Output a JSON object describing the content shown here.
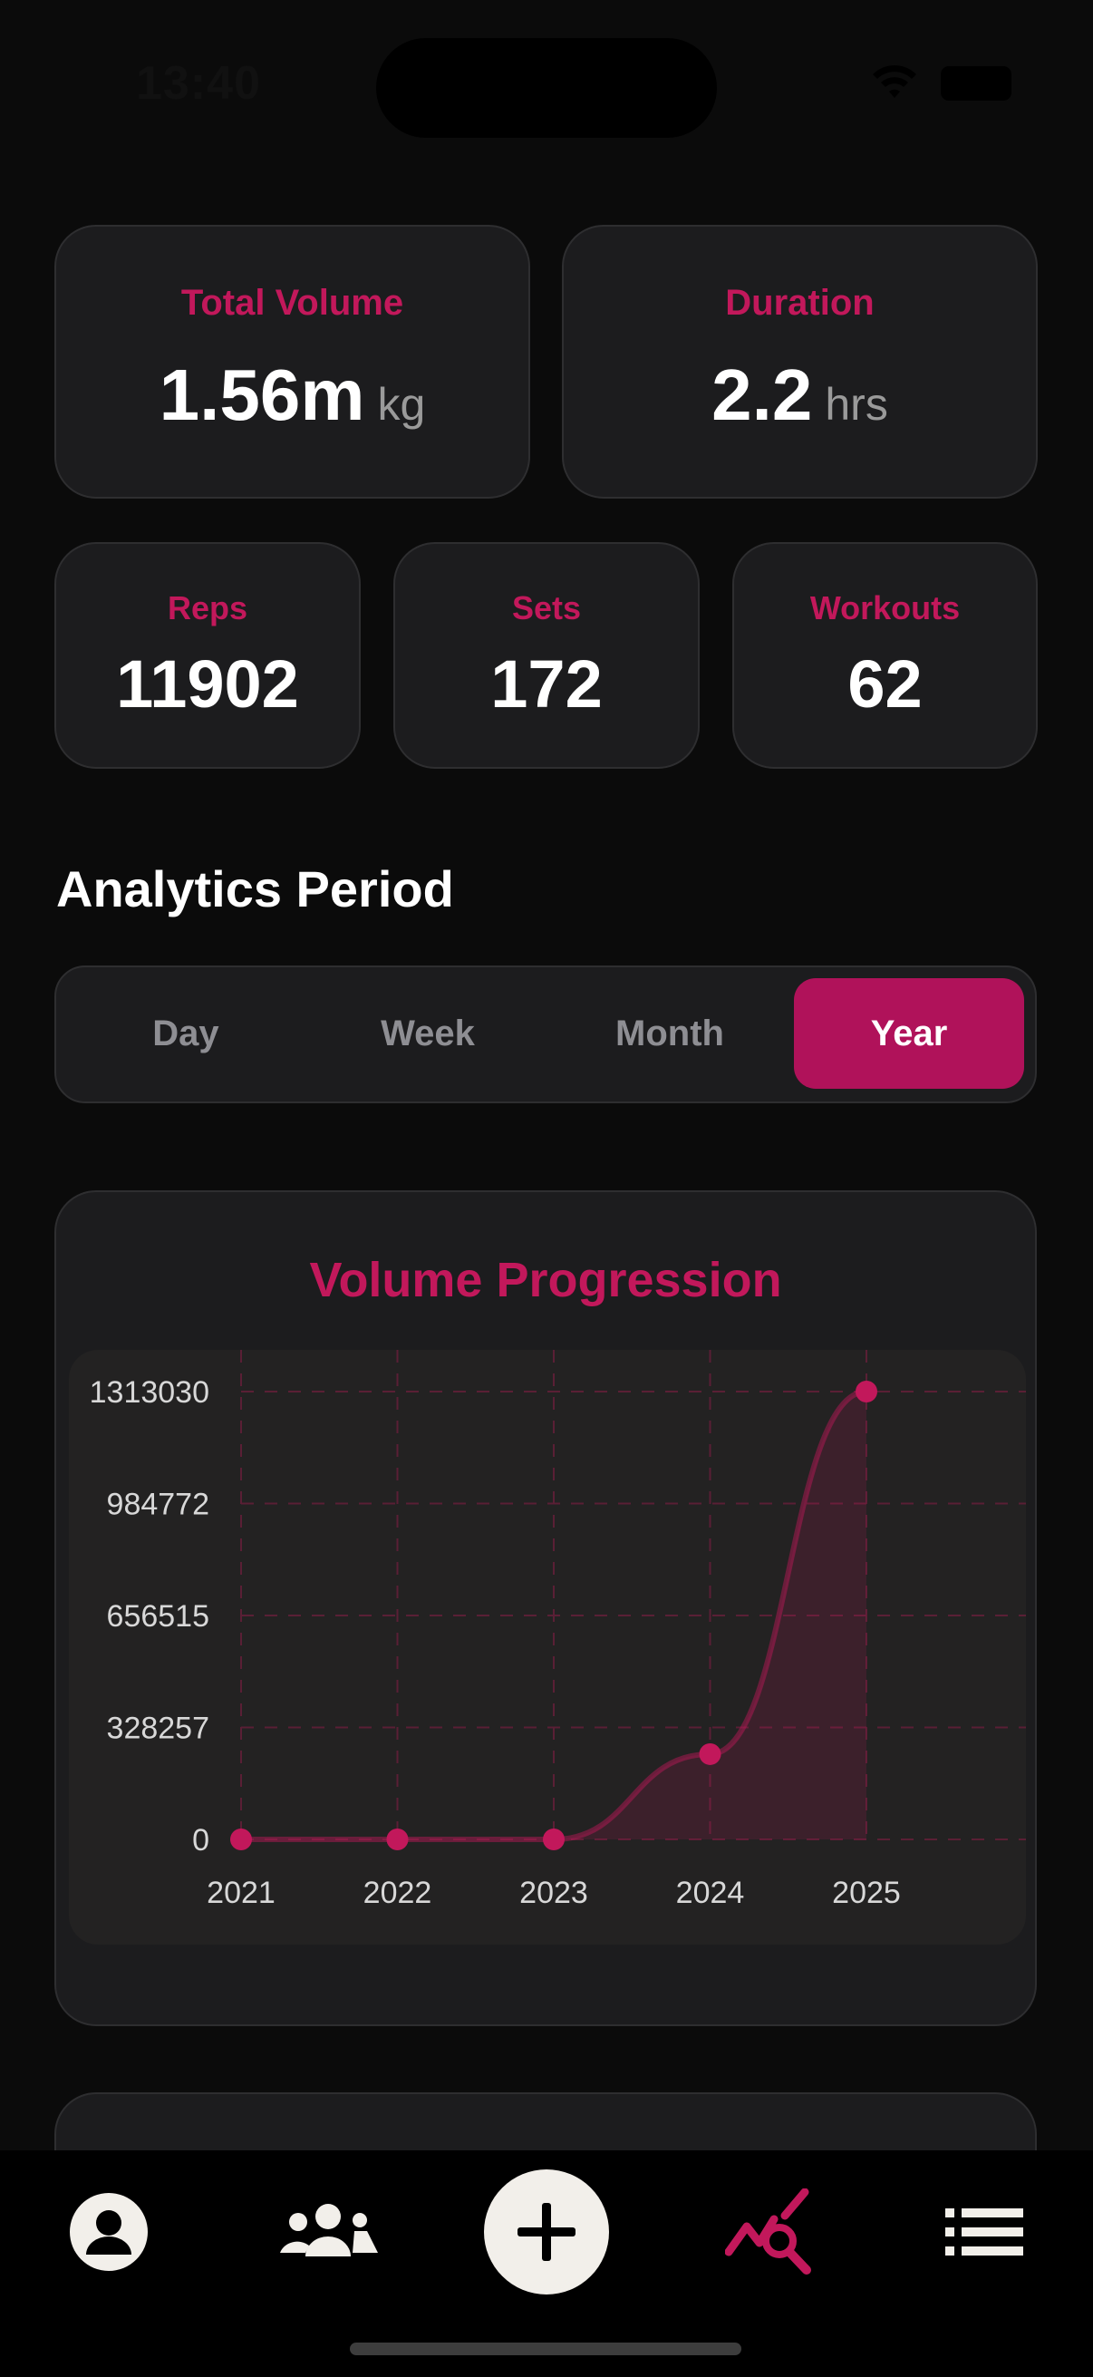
{
  "status": {
    "time": "13:40"
  },
  "stats": {
    "total_volume": {
      "label": "Total Volume",
      "value": "1.56m",
      "unit": "kg"
    },
    "duration": {
      "label": "Duration",
      "value": "2.2",
      "unit": "hrs"
    },
    "reps": {
      "label": "Reps",
      "value": "11902"
    },
    "sets": {
      "label": "Sets",
      "value": "172"
    },
    "workouts": {
      "label": "Workouts",
      "value": "62"
    }
  },
  "period": {
    "title": "Analytics Period",
    "options": [
      "Day",
      "Week",
      "Month",
      "Year"
    ],
    "selected": "Year"
  },
  "chart_data": {
    "type": "line",
    "title": "Volume Progression",
    "x": [
      "2021",
      "2022",
      "2023",
      "2024",
      "2025"
    ],
    "series": [
      {
        "values": [
          0,
          0,
          0,
          250000,
          1313030
        ]
      }
    ],
    "y_ticks": [
      "0",
      "328257",
      "656515",
      "984772",
      "1313030"
    ],
    "ylim": [
      0,
      1313030
    ],
    "grid": true,
    "color": "#c2185b"
  },
  "tabbar": {
    "items": [
      "profile-icon",
      "community-icon",
      "add-icon",
      "analytics-icon",
      "list-icon"
    ],
    "active": "analytics-icon"
  },
  "colors": {
    "accent": "#c2185b",
    "background": "#0b0b0b",
    "card": "#1c1c1e"
  }
}
